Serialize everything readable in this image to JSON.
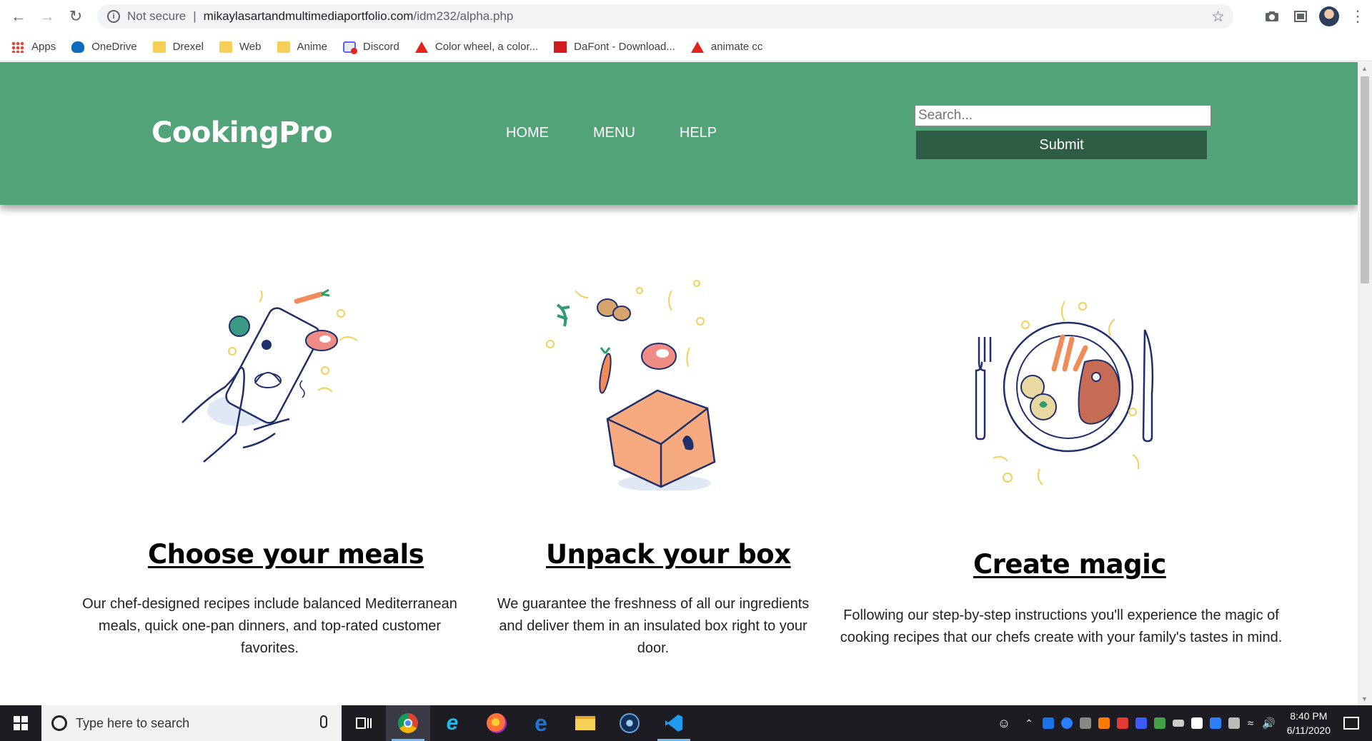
{
  "browser": {
    "security_label": "Not secure",
    "url_host": "mikaylasartandmultimediaportfolio.com",
    "url_path": "/idm232/alpha.php",
    "bookmarks": [
      {
        "label": "Apps",
        "icon": "apps-grid-icon"
      },
      {
        "label": "OneDrive",
        "icon": "onedrive-cloud-icon"
      },
      {
        "label": "Drexel",
        "icon": "folder-icon"
      },
      {
        "label": "Web",
        "icon": "folder-icon"
      },
      {
        "label": "Anime",
        "icon": "folder-icon"
      },
      {
        "label": "Discord",
        "icon": "discord-icon"
      },
      {
        "label": "Color wheel, a color...",
        "icon": "adobe-icon"
      },
      {
        "label": "DaFont - Download...",
        "icon": "dafont-icon"
      },
      {
        "label": "animate cc",
        "icon": "adobe-icon"
      }
    ]
  },
  "site": {
    "logo": "CookingPro",
    "nav": [
      "HOME",
      "MENU",
      "HELP"
    ],
    "search_placeholder": "Search...",
    "submit_label": "Submit",
    "brand_color": "#53a378",
    "button_color": "#2f5c44"
  },
  "features": [
    {
      "title": "Choose your meals",
      "text": "Our chef-designed recipes include balanced Mediterranean meals, quick one-pan dinners, and top-rated customer favorites."
    },
    {
      "title": "Unpack your box",
      "text": "We guarantee the freshness of all our ingredients and deliver them in an insulated box right to your door."
    },
    {
      "title": "Create magic",
      "text": "Following our step-by-step instructions you'll experience the magic of cooking recipes that our chefs create with your family's tastes in mind."
    }
  ],
  "taskbar": {
    "search_placeholder": "Type here to search",
    "time": "8:40 PM",
    "date": "6/11/2020"
  }
}
